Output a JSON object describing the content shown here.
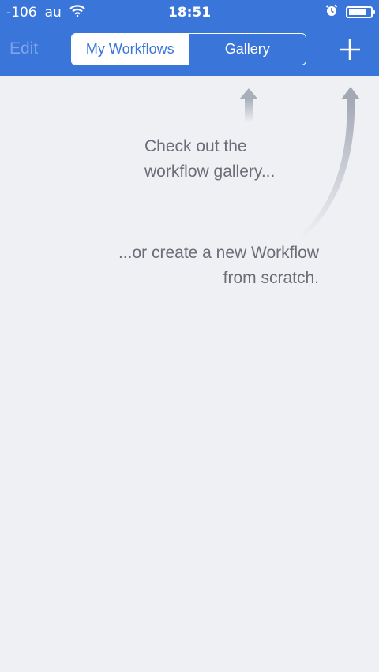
{
  "status_bar": {
    "signal": "-106",
    "carrier": "au",
    "time": "18:51",
    "wifi_icon": "wifi-icon",
    "alarm_icon": "alarm-icon",
    "battery_level": 0.8
  },
  "nav": {
    "edit_label": "Edit",
    "tabs": [
      {
        "label": "My Workflows",
        "selected": true
      },
      {
        "label": "Gallery",
        "selected": false
      }
    ],
    "add_icon": "plus-icon"
  },
  "hints": {
    "gallery_line1": "Check out the",
    "gallery_line2": "workflow gallery...",
    "create_line1": "...or create a new Workflow",
    "create_line2": "from scratch."
  },
  "colors": {
    "accent": "#3a75d9",
    "background": "#eff0f4",
    "hint_text": "#6b6d78"
  }
}
